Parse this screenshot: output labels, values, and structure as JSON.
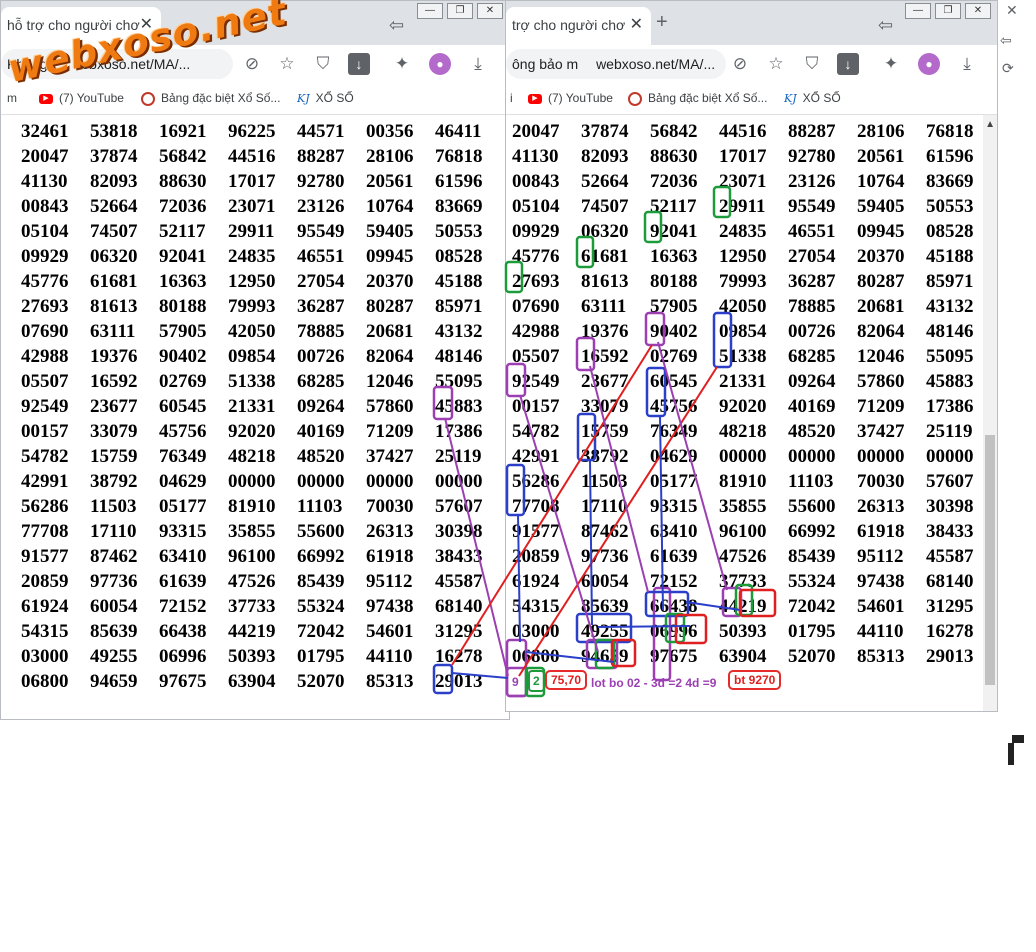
{
  "watermark": "webxoso.net",
  "left_window": {
    "tab_title": "hỗ trợ cho người chơ",
    "tab_close": "✕",
    "back_glyph": "⇦",
    "url_prefix": "Không",
    "url_host": "ebxoso.net/MA/...",
    "bookmark_partial": "m",
    "bookmarks": [
      "(7) YouTube",
      "Bảng đặc biệt Xổ Số...",
      "XỔ SỐ"
    ]
  },
  "right_window": {
    "tab_title": "trợ cho người chơ",
    "tab_close": "✕",
    "new_tab": "+",
    "back_glyph": "⇦",
    "url_prefix": "ông bảo m",
    "url_host": "webxoso.net/MA/...",
    "bookmark_partial": "i",
    "bookmarks": [
      "(7) YouTube",
      "Bảng đặc biệt Xổ Số...",
      "XỔ SỐ"
    ]
  },
  "window_controls": [
    "—",
    "❐",
    "✕"
  ],
  "icons": {
    "blocked": "blocked-site-icon",
    "star": "star-icon",
    "shield": "shield-icon",
    "download": "download-icon",
    "puzzle": "extensions-icon",
    "profile": "profile-icon",
    "install": "install-icon"
  },
  "colors": {
    "red": "#e02020",
    "purple": "#9b3fb2",
    "blue": "#2b3fc9",
    "green": "#1c9b3a",
    "watermark": "#f07a12"
  },
  "left_grid": [
    [
      "32461",
      "53818",
      "16921",
      "96225",
      "44571",
      "00356",
      "46411"
    ],
    [
      "20047",
      "37874",
      "56842",
      "44516",
      "88287",
      "28106",
      "76818"
    ],
    [
      "41130",
      "82093",
      "88630",
      "17017",
      "92780",
      "20561",
      "61596"
    ],
    [
      "00843",
      "52664",
      "72036",
      "23071",
      "23126",
      "10764",
      "83669"
    ],
    [
      "05104",
      "74507",
      "52117",
      "29911",
      "95549",
      "59405",
      "50553"
    ],
    [
      "09929",
      "06320",
      "92041",
      "24835",
      "46551",
      "09945",
      "08528"
    ],
    [
      "45776",
      "61681",
      "16363",
      "12950",
      "27054",
      "20370",
      "45188"
    ],
    [
      "27693",
      "81613",
      "80188",
      "79993",
      "36287",
      "80287",
      "85971"
    ],
    [
      "07690",
      "63111",
      "57905",
      "42050",
      "78885",
      "20681",
      "43132"
    ],
    [
      "42988",
      "19376",
      "90402",
      "09854",
      "00726",
      "82064",
      "48146"
    ],
    [
      "05507",
      "16592",
      "02769",
      "51338",
      "68285",
      "12046",
      "55095"
    ],
    [
      "92549",
      "23677",
      "60545",
      "21331",
      "09264",
      "57860",
      "45883"
    ],
    [
      "00157",
      "33079",
      "45756",
      "92020",
      "40169",
      "71209",
      "17386"
    ],
    [
      "54782",
      "15759",
      "76349",
      "48218",
      "48520",
      "37427",
      "25119"
    ],
    [
      "42991",
      "38792",
      "04629",
      "00000",
      "00000",
      "00000",
      "00000"
    ],
    [
      "56286",
      "11503",
      "05177",
      "81910",
      "11103",
      "70030",
      "57607"
    ],
    [
      "77708",
      "17110",
      "93315",
      "35855",
      "55600",
      "26313",
      "30398"
    ],
    [
      "91577",
      "87462",
      "63410",
      "96100",
      "66992",
      "61918",
      "38433"
    ],
    [
      "20859",
      "97736",
      "61639",
      "47526",
      "85439",
      "95112",
      "45587"
    ],
    [
      "61924",
      "60054",
      "72152",
      "37733",
      "55324",
      "97438",
      "68140"
    ],
    [
      "54315",
      "85639",
      "66438",
      "44219",
      "72042",
      "54601",
      "31295"
    ],
    [
      "03000",
      "49255",
      "06996",
      "50393",
      "01795",
      "44110",
      "16278"
    ],
    [
      "06800",
      "94659",
      "97675",
      "63904",
      "52070",
      "85313",
      "29013"
    ]
  ],
  "right_grid": [
    [
      "20047",
      "37874",
      "56842",
      "44516",
      "88287",
      "28106",
      "76818"
    ],
    [
      "41130",
      "82093",
      "88630",
      "17017",
      "92780",
      "20561",
      "61596"
    ],
    [
      "00843",
      "52664",
      "72036",
      "23071",
      "23126",
      "10764",
      "83669"
    ],
    [
      "05104",
      "74507",
      "52117",
      "29911",
      "95549",
      "59405",
      "50553"
    ],
    [
      "09929",
      "06320",
      "92041",
      "24835",
      "46551",
      "09945",
      "08528"
    ],
    [
      "45776",
      "61681",
      "16363",
      "12950",
      "27054",
      "20370",
      "45188"
    ],
    [
      "27693",
      "81613",
      "80188",
      "79993",
      "36287",
      "80287",
      "85971"
    ],
    [
      "07690",
      "63111",
      "57905",
      "42050",
      "78885",
      "20681",
      "43132"
    ],
    [
      "42988",
      "19376",
      "90402",
      "09854",
      "00726",
      "82064",
      "48146"
    ],
    [
      "05507",
      "16592",
      "02769",
      "51338",
      "68285",
      "12046",
      "55095"
    ],
    [
      "92549",
      "23677",
      "60545",
      "21331",
      "09264",
      "57860",
      "45883"
    ],
    [
      "00157",
      "33079",
      "45756",
      "92020",
      "40169",
      "71209",
      "17386"
    ],
    [
      "54782",
      "15759",
      "76349",
      "48218",
      "48520",
      "37427",
      "25119"
    ],
    [
      "42991",
      "38792",
      "04629",
      "00000",
      "00000",
      "00000",
      "00000"
    ],
    [
      "56286",
      "11503",
      "05177",
      "81910",
      "11103",
      "70030",
      "57607"
    ],
    [
      "77708",
      "17110",
      "93315",
      "35855",
      "55600",
      "26313",
      "30398"
    ],
    [
      "91577",
      "87462",
      "63410",
      "96100",
      "66992",
      "61918",
      "38433"
    ],
    [
      "20859",
      "97736",
      "61639",
      "47526",
      "85439",
      "95112",
      "45587"
    ],
    [
      "61924",
      "60054",
      "72152",
      "37733",
      "55324",
      "97438",
      "68140"
    ],
    [
      "54315",
      "85639",
      "66438",
      "44219",
      "72042",
      "54601",
      "31295"
    ],
    [
      "03000",
      "49255",
      "06996",
      "50393",
      "01795",
      "44110",
      "16278"
    ],
    [
      "06800",
      "94659",
      "97675",
      "63904",
      "52070",
      "85313",
      "29013"
    ]
  ],
  "annotations": {
    "n9": "9",
    "n2": "2",
    "n7570": "75,70",
    "lot": "lot bo 02 - 3d =2 4d =9",
    "bt": "bt 9270"
  }
}
